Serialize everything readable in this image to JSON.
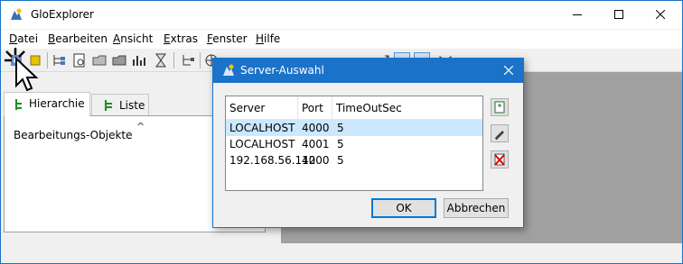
{
  "window": {
    "title": "GloExplorer"
  },
  "menu": [
    {
      "key": "datei",
      "underline": "D",
      "rest": "atei"
    },
    {
      "key": "bearbeiten",
      "underline": "B",
      "rest": "earbeiten"
    },
    {
      "key": "ansicht",
      "underline": "A",
      "rest": "nsicht"
    },
    {
      "key": "extras",
      "underline": "E",
      "rest": "xtras"
    },
    {
      "key": "fenster",
      "underline": "F",
      "rest": "enster"
    },
    {
      "key": "hilfe",
      "underline": "H",
      "rest": "ilfe"
    }
  ],
  "tabs": {
    "hierarchy": "Hierarchie",
    "list": "Liste"
  },
  "panel": {
    "heading": "Bearbeitungs-Objekte"
  },
  "dialog": {
    "title": "Server-Auswahl",
    "columns": [
      "Server",
      "Port",
      "TimeOutSec"
    ],
    "rows": [
      {
        "server": "LOCALHOST",
        "port": "4000",
        "timeout": "5"
      },
      {
        "server": "LOCALHOST",
        "port": "4001",
        "timeout": "5"
      },
      {
        "server": "192.168.56.112",
        "port": "4000",
        "timeout": "5"
      }
    ],
    "ok": "OK",
    "cancel": "Abbrechen"
  },
  "colors": {
    "accent": "#1a73c9",
    "selection": "#cce8ff",
    "workspace": "#a0a0a0"
  }
}
